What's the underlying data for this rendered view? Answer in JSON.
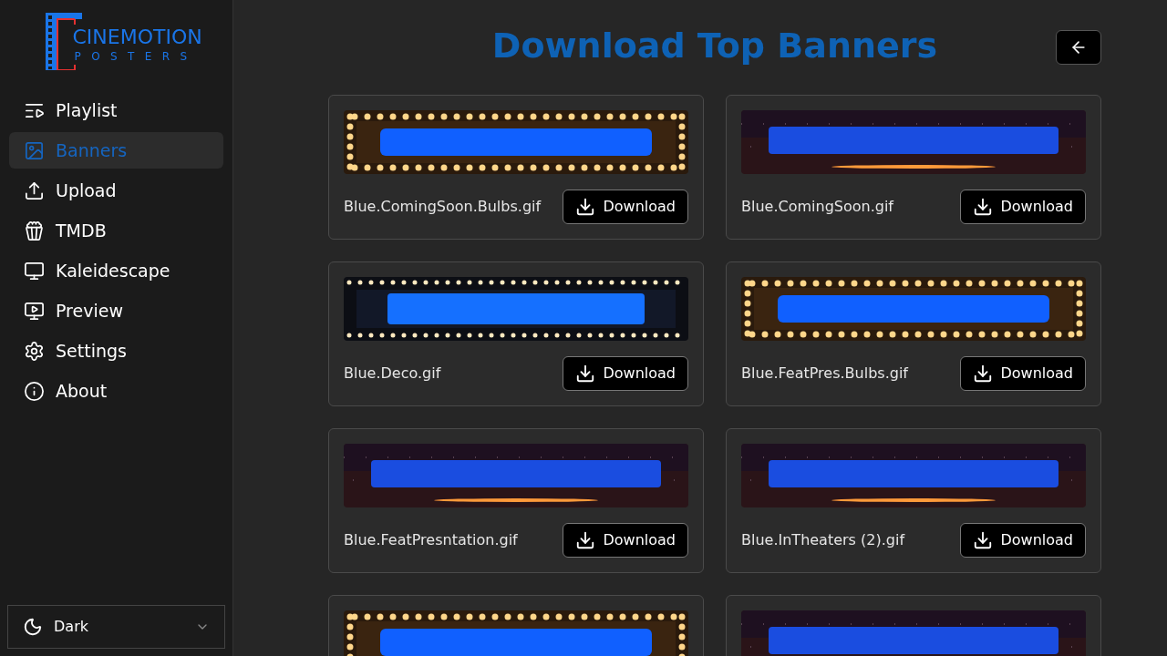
{
  "logo": {
    "title": "CINEMOTION",
    "subtitle": "POSTERS"
  },
  "sidebar": {
    "items": [
      {
        "label": "Playlist",
        "selected": false
      },
      {
        "label": "Banners",
        "selected": true
      },
      {
        "label": "Upload",
        "selected": false
      },
      {
        "label": "TMDB",
        "selected": false
      },
      {
        "label": "Kaleidescape",
        "selected": false
      },
      {
        "label": "Preview",
        "selected": false
      },
      {
        "label": "Settings",
        "selected": false
      },
      {
        "label": "About",
        "selected": false
      }
    ],
    "theme_select": {
      "value": "Dark"
    }
  },
  "page": {
    "title": "Download Top Banners"
  },
  "banners": [
    {
      "kind": "bulbs",
      "filename": "Blue.ComingSoon.Bulbs.gif",
      "button": "Download"
    },
    {
      "kind": "stars",
      "filename": "Blue.ComingSoon.gif",
      "button": "Download"
    },
    {
      "kind": "deco",
      "filename": "Blue.Deco.gif",
      "button": "Download"
    },
    {
      "kind": "bulbs",
      "filename": "Blue.FeatPres.Bulbs.gif",
      "button": "Download"
    },
    {
      "kind": "stars",
      "filename": "Blue.FeatPresntation.gif",
      "button": "Download"
    },
    {
      "kind": "stars",
      "filename": "Blue.InTheaters (2).gif",
      "button": "Download"
    },
    {
      "kind": "bulbs"
    },
    {
      "kind": "stars"
    }
  ]
}
